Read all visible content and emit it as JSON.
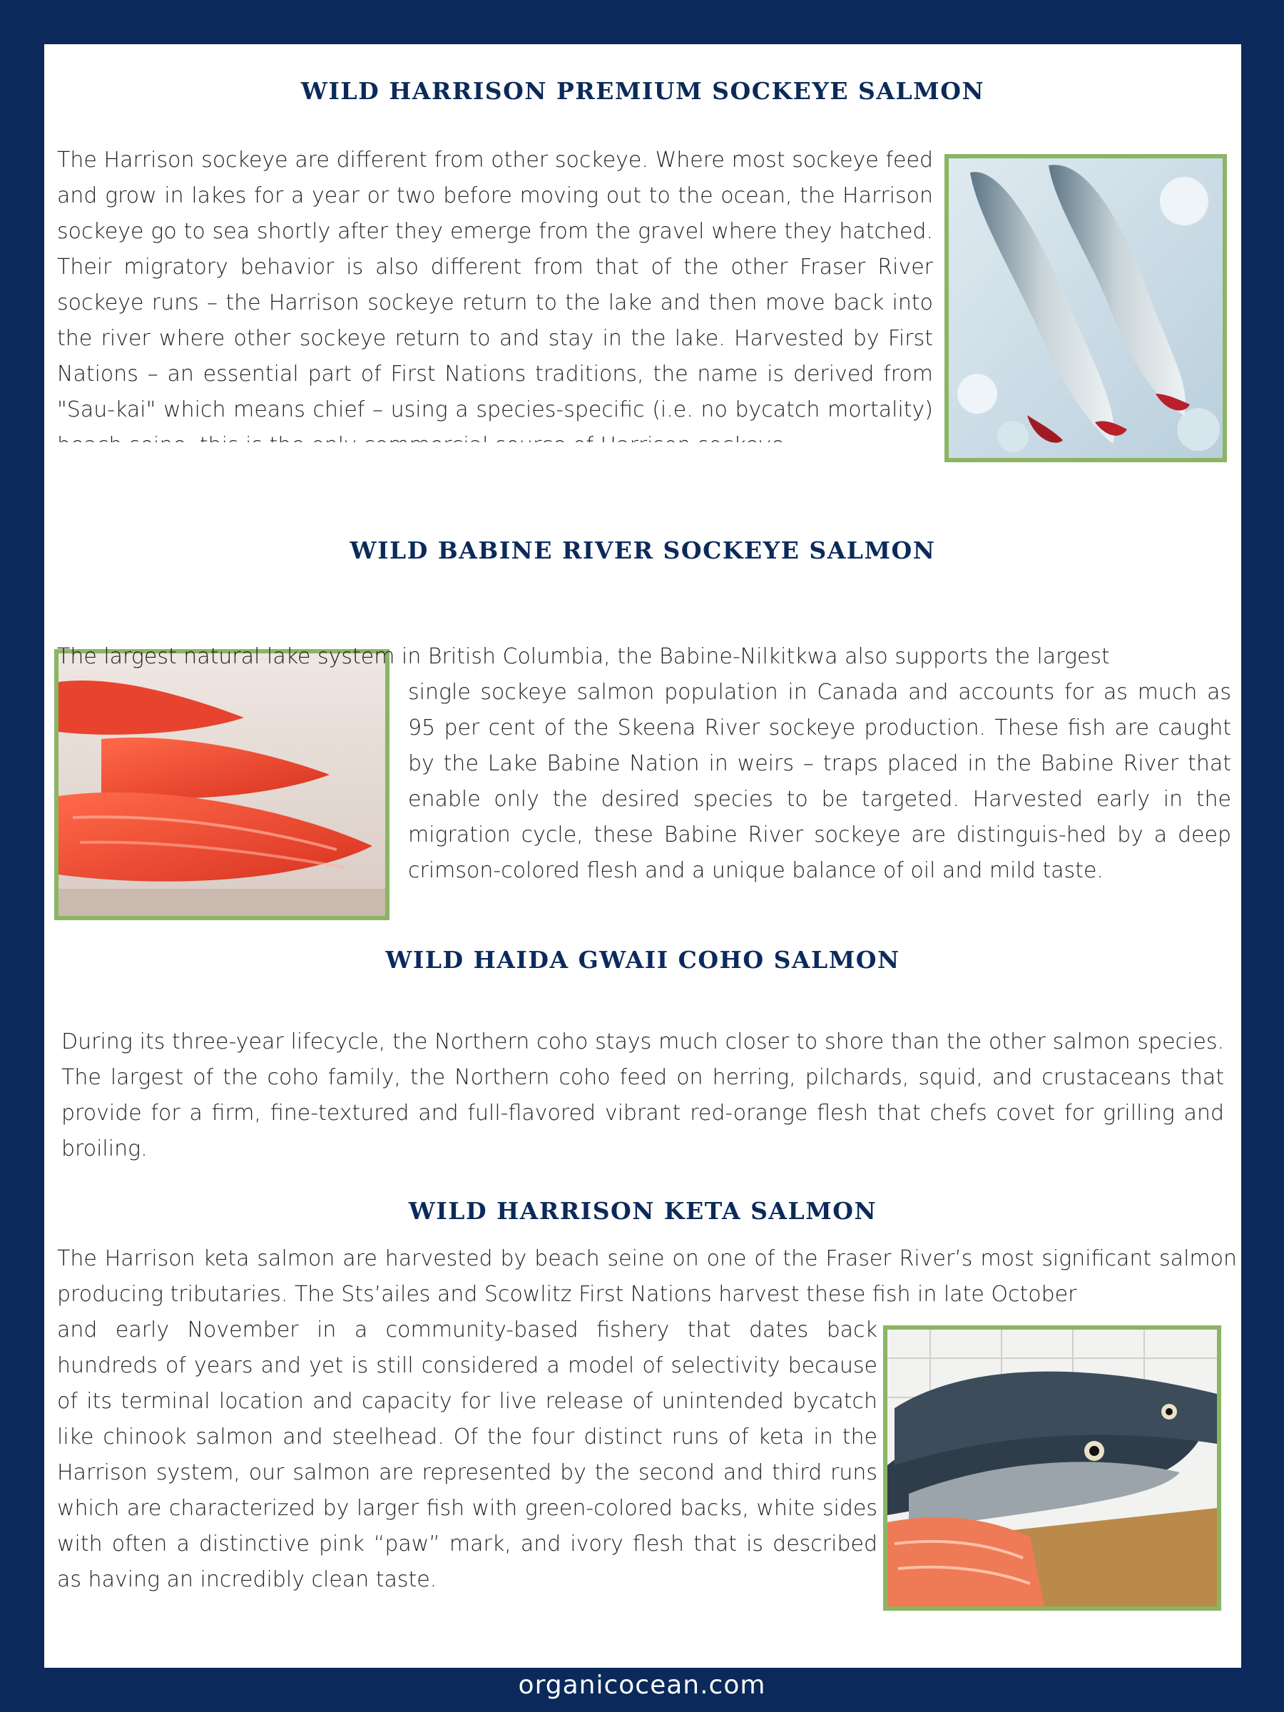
{
  "sections": [
    {
      "title": "WILD HARRISON PREMIUM SOCKEYE SALMON",
      "body": "The Harrison sockeye are different from other sockeye. Where most sockeye feed and grow in lakes for a year or two before moving out to the ocean, the Harrison sockeye go to sea shortly after they emerge from the gravel where they hatched. Their migratory behavior is also different from that of the other Fraser River sockeye runs – the Harrison sockeye return to the lake and then move back into the river where other sockeye return to and stay in the lake. Harvested by First Nations – an essential part of First Nations traditions, the name is derived from \"Sau-kai\" which means chief – using a species-specific (i.e. no bycatch mortality) beach seine, this is the only commercial source of Harrison sockeye."
    },
    {
      "title": "WILD BABINE RIVER SOCKEYE SALMON",
      "body": "The largest natural lake system in British Columbia, the Babine-Nilkitkwa also supports the largest single sockeye salmon population in Canada and accounts for as much as 95 per cent of the Skeena River sockeye production. These fish are caught by the Lake Babine Nation in weirs – traps placed in the Babine River that enable only the desired species to be targeted. Harvested early in the migration cycle, these Babine River sockeye are distinguis-hed by a deep crimson-colored flesh and a unique balance of oil and mild taste."
    },
    {
      "title": "WILD HAIDA GWAII COHO SALMON",
      "body": "During its three-year lifecycle, the Northern coho stays much closer to shore than the other salmon species. The largest of the coho family, the Northern coho feed on herring, pilchards, squid, and crustaceans that provide for a firm, fine-textured and full-flavored vibrant red-orange flesh that chefs covet for grilling and broiling."
    },
    {
      "title": "WILD HARRISON KETA SALMON",
      "body": "The Harrison keta salmon are harvested by beach seine on one of the Fraser River’s most significant salmon producing tributaries. The Sts’ailes and Scowlitz First Nations harvest these fish in late October and early November in a community-based fishery that dates back hundreds of years and yet is still considered a model of selectivity because of its terminal location and capacity for live release of unintended bycatch like chinook salmon and steelhead. Of the four distinct runs of keta in the Harrison system, our salmon are represented by the second and third runs which are characterized by larger fish with green-colored backs, white sides with often a distinctive pink “paw” mark, and ivory flesh that is described as having an incredibly clean taste."
    }
  ],
  "footer": "organicocean.com",
  "colors": {
    "navy": "#0b2a5b",
    "frame_green": "#8bb563"
  }
}
